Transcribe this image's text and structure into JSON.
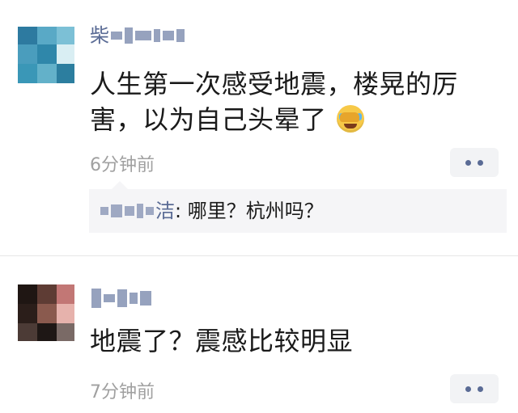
{
  "post1": {
    "author_visible_char": "柴",
    "content_line1": "人生第一次感受地震，楼晃的厉",
    "content_line2": "害，以为自己头晕了",
    "emoji": "facepalm-crying-emoji",
    "time": "6分钟前",
    "reply": {
      "author_visible_char": "洁",
      "separator": ": ",
      "text": "哪里？杭州吗？"
    }
  },
  "post2": {
    "content": "地震了？震感比较明显",
    "time": "7分钟前"
  },
  "colors": {
    "link_blue": "#5a6b95",
    "time_gray": "#a0a0a0",
    "text": "#1a1a1a",
    "reply_bg": "#f5f5f7"
  }
}
